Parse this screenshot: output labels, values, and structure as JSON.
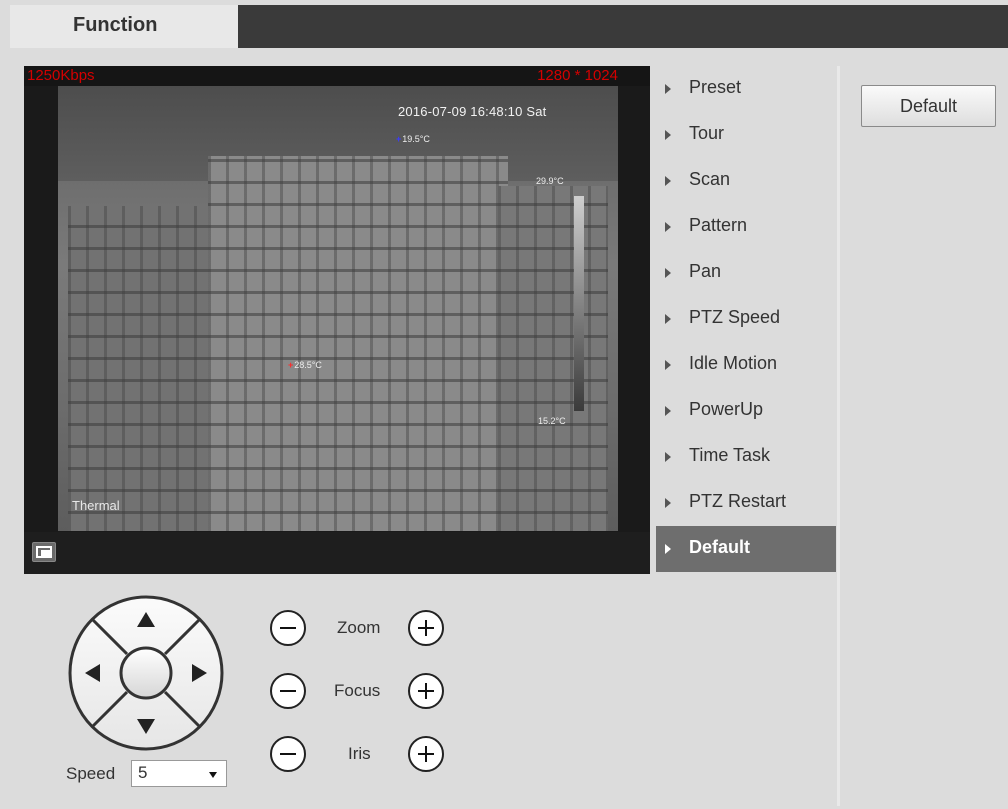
{
  "tab": {
    "label": "Function"
  },
  "video": {
    "bitrate": "1250Kbps",
    "resolution": "1280 * 1024",
    "timestamp": "2016-07-09 16:48:10 Sat",
    "temp_point_blue": "19.5°C",
    "temp_point_red": "28.5°C",
    "scale_max": "29.9°C",
    "scale_min": "15.2°C",
    "channel_label": "Thermal"
  },
  "menu": {
    "items": [
      {
        "label": "Preset"
      },
      {
        "label": "Tour"
      },
      {
        "label": "Scan"
      },
      {
        "label": "Pattern"
      },
      {
        "label": "Pan"
      },
      {
        "label": "PTZ Speed"
      },
      {
        "label": "Idle Motion"
      },
      {
        "label": "PowerUp"
      },
      {
        "label": "Time Task"
      },
      {
        "label": "PTZ Restart"
      },
      {
        "label": "Default"
      }
    ],
    "active": "Default"
  },
  "panel": {
    "default_button": "Default"
  },
  "ptz": {
    "speed_label": "Speed",
    "speed_value": "5",
    "zoom_label": "Zoom",
    "focus_label": "Focus",
    "iris_label": "Iris"
  },
  "colors": {
    "overlay_red": "#d40000",
    "active_menu_bg": "#6e6e6e",
    "topbar": "#3a3a3a"
  }
}
